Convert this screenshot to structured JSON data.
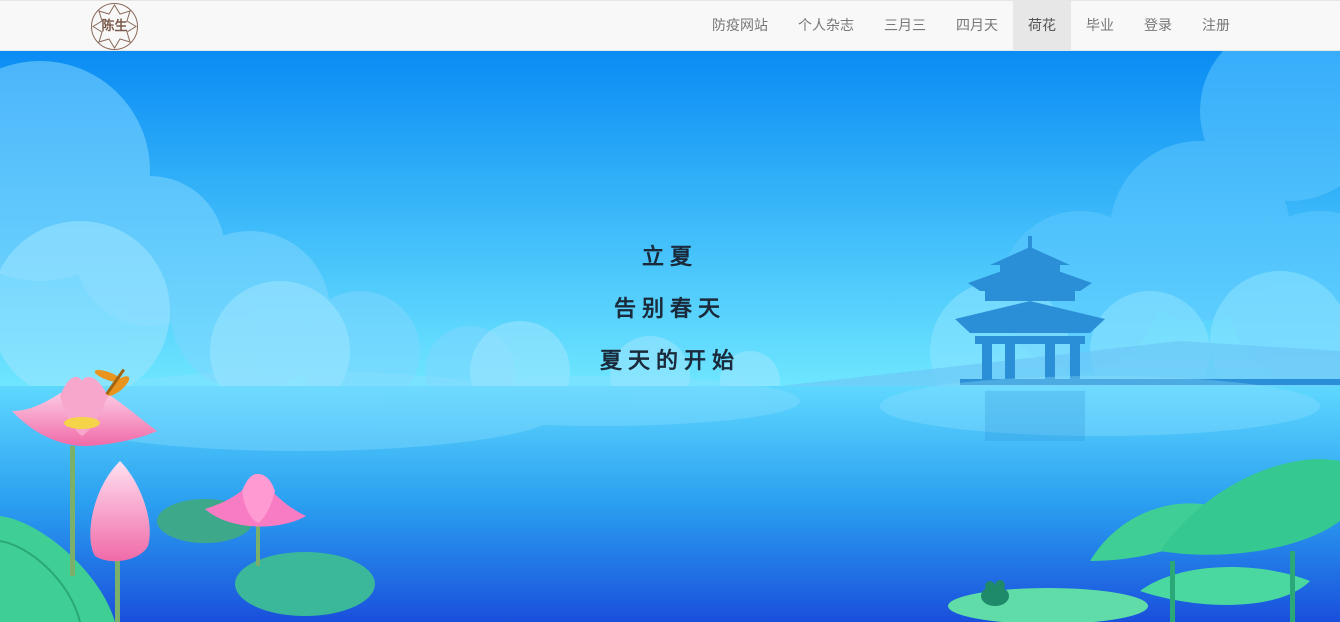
{
  "logo": {
    "text": "陈生"
  },
  "nav": {
    "items": [
      {
        "label": "防疫网站",
        "active": false
      },
      {
        "label": "个人杂志",
        "active": false
      },
      {
        "label": "三月三",
        "active": false
      },
      {
        "label": "四月天",
        "active": false
      },
      {
        "label": "荷花",
        "active": true
      },
      {
        "label": "毕业",
        "active": false
      },
      {
        "label": "登录",
        "active": false
      },
      {
        "label": "注册",
        "active": false
      }
    ]
  },
  "hero": {
    "lines": [
      "立夏",
      "告别春天",
      "夏天的开始"
    ]
  },
  "colors": {
    "sky_top": "#0a8ff5",
    "sky_bottom": "#6fe3ff",
    "water_top": "#5fd4ff",
    "water_bottom": "#1e5fe0",
    "pavilion": "#2a8fd6",
    "lotus_leaf": "#35c98f",
    "lotus_flower": "#f48cc8"
  }
}
